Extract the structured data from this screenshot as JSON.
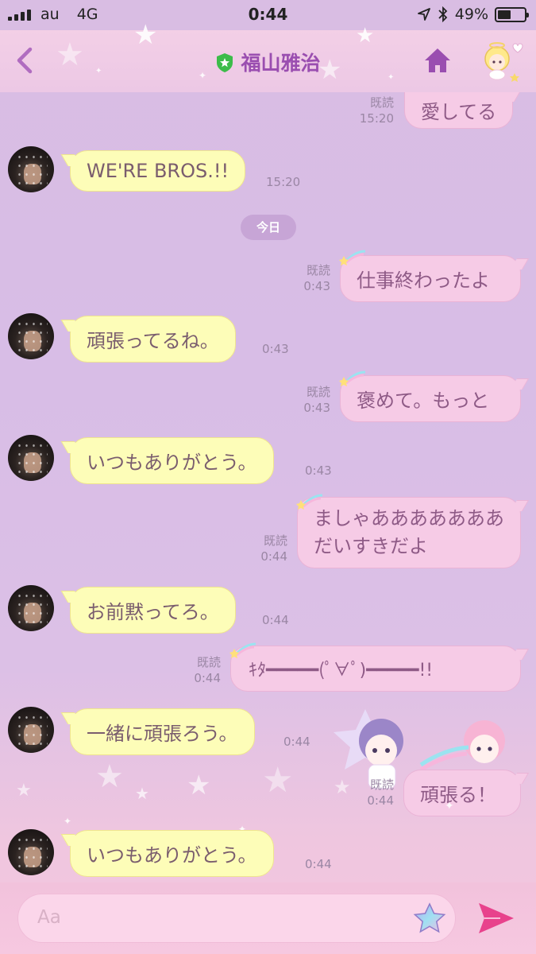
{
  "status_bar": {
    "carrier": "au",
    "network": "4G",
    "time": "0:44",
    "battery_text": "49%",
    "battery_level": 0.49
  },
  "header": {
    "title": "福山雅治",
    "icons": [
      "back-icon",
      "shield-icon",
      "home-icon",
      "angel-icon"
    ]
  },
  "messages": {
    "m0": {
      "text": "愛してる",
      "read": "既読",
      "time": "15:20"
    },
    "m1": {
      "text": "WE'RE BROS.!!",
      "time": "15:20"
    },
    "date": "今日",
    "m2": {
      "text": "仕事終わったよ",
      "read": "既読",
      "time": "0:43"
    },
    "m3": {
      "text": "頑張ってるね。",
      "time": "0:43"
    },
    "m4": {
      "text": "褒めて。もっと",
      "read": "既読",
      "time": "0:43"
    },
    "m5": {
      "text": "いつもありがとう。",
      "time": "0:43"
    },
    "m6": {
      "line1": "ましゃあああああああ",
      "line2": "だいすきだよ",
      "read": "既読",
      "time": "0:44"
    },
    "m7": {
      "text": "お前黙ってろ。",
      "time": "0:44"
    },
    "m8": {
      "text": "ｷﾀ━━━━━(ﾟ∀ﾟ)━━━━━!!",
      "read": "既読",
      "time": "0:44"
    },
    "m9": {
      "text": "一緒に頑張ろう。",
      "time": "0:44"
    },
    "m10": {
      "text": "頑張る！",
      "read": "既読",
      "time": "0:44"
    },
    "m11": {
      "text": "いつもありがとう。",
      "time": "0:44"
    }
  },
  "input": {
    "placeholder": "Aa"
  },
  "colors": {
    "incoming_bubble": "#fdfdb8",
    "outgoing_bubble": "#f6cbe6",
    "title": "#9a4eb0",
    "send": "#e8428c"
  }
}
